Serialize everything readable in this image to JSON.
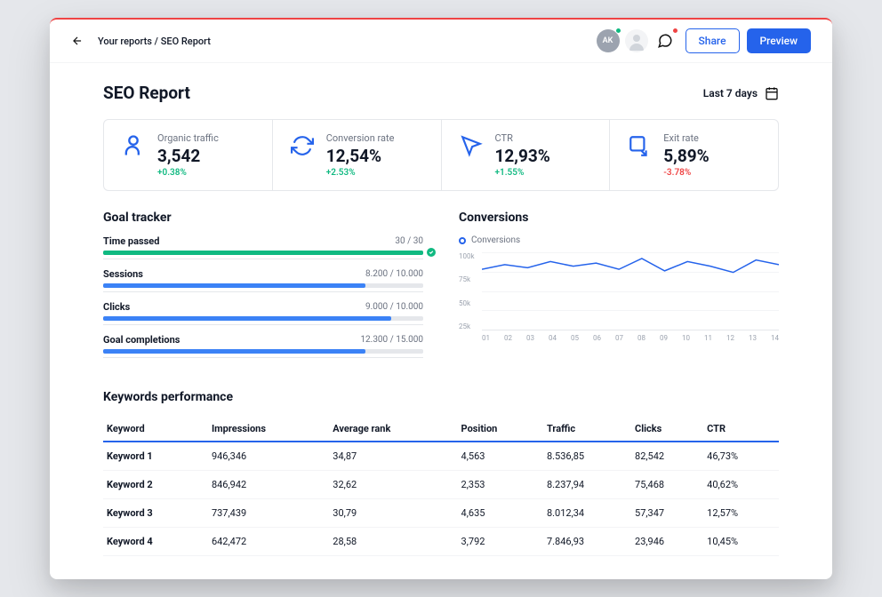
{
  "header": {
    "breadcrumb": "Your reports / SEO Report",
    "avatar_initials": "AK",
    "share_label": "Share",
    "preview_label": "Preview"
  },
  "title": "SEO Report",
  "date_range": "Last 7 days",
  "cards": [
    {
      "label": "Organic traffic",
      "value": "3,542",
      "change": "+0.38%",
      "positive": true,
      "icon": "user"
    },
    {
      "label": "Conversion rate",
      "value": "12,54%",
      "change": "+2.53%",
      "positive": true,
      "icon": "sync"
    },
    {
      "label": "CTR",
      "value": "12,93%",
      "change": "+1.55%",
      "positive": true,
      "icon": "cursor"
    },
    {
      "label": "Exit rate",
      "value": "5,89%",
      "change": "-3.78%",
      "positive": false,
      "icon": "exit"
    }
  ],
  "goal_tracker": {
    "title": "Goal tracker",
    "items": [
      {
        "name": "Time passed",
        "value": "30 / 30",
        "pct": 100,
        "color": "#10b981",
        "complete": true
      },
      {
        "name": "Sessions",
        "value": "8.200 / 10.000",
        "pct": 82,
        "color": "#3b82f6",
        "complete": false
      },
      {
        "name": "Clicks",
        "value": "9.000 / 10.000",
        "pct": 90,
        "color": "#3b82f6",
        "complete": false
      },
      {
        "name": "Goal completions",
        "value": "12.300 / 15.000",
        "pct": 82,
        "color": "#3b82f6",
        "complete": false
      }
    ]
  },
  "conversions": {
    "title": "Conversions",
    "legend": "Conversions"
  },
  "chart_data": {
    "type": "line",
    "title": "Conversions",
    "xlabel": "",
    "ylabel": "",
    "ylim": [
      0,
      100000
    ],
    "yticks": [
      "100k",
      "75k",
      "50k",
      "25k"
    ],
    "categories": [
      "01",
      "02",
      "03",
      "04",
      "05",
      "06",
      "07",
      "08",
      "09",
      "10",
      "11",
      "12",
      "13",
      "14"
    ],
    "series": [
      {
        "name": "Conversions",
        "values": [
          78000,
          84000,
          80000,
          88000,
          82000,
          86000,
          78000,
          92000,
          76000,
          88000,
          82000,
          74000,
          90000,
          84000
        ]
      }
    ]
  },
  "keywords": {
    "title": "Keywords performance",
    "columns": [
      "Keyword",
      "Impressions",
      "Average rank",
      "Position",
      "Traffic",
      "Clicks",
      "CTR"
    ],
    "rows": [
      {
        "keyword": "Keyword 1",
        "impressions": "946,346",
        "avg_rank": "34,87",
        "position": "4,563",
        "traffic": "8.536,85",
        "clicks": "82,542",
        "ctr": "46,73%"
      },
      {
        "keyword": "Keyword 2",
        "impressions": "846,942",
        "avg_rank": "32,62",
        "position": "2,353",
        "traffic": "8.237,94",
        "clicks": "75,468",
        "ctr": "40,62%"
      },
      {
        "keyword": "Keyword 3",
        "impressions": "737,439",
        "avg_rank": "30,79",
        "position": "4,635",
        "traffic": "8.012,34",
        "clicks": "57,347",
        "ctr": "12,57%"
      },
      {
        "keyword": "Keyword 4",
        "impressions": "642,472",
        "avg_rank": "28,58",
        "position": "3,792",
        "traffic": "7.846,93",
        "clicks": "23,946",
        "ctr": "10,45%"
      }
    ]
  }
}
